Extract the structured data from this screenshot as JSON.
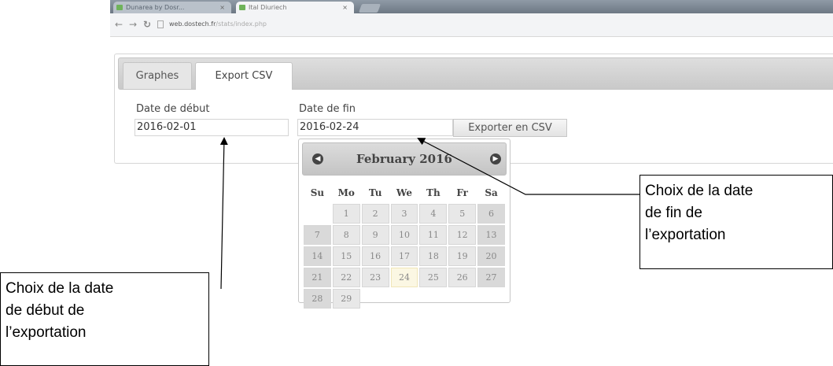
{
  "browser": {
    "tabs": [
      {
        "label": "Dunarea by Dosr..."
      },
      {
        "label": "Ital Diuriech"
      }
    ],
    "url_host": "web.dostech.fr",
    "url_path": "/stats/index.php"
  },
  "page": {
    "tabs": [
      {
        "label": "Graphes"
      },
      {
        "label": "Export CSV"
      }
    ],
    "start_date": {
      "label": "Date de début",
      "value": "2016-02-01"
    },
    "end_date": {
      "label": "Date de fin",
      "value": "2016-02-24"
    },
    "export_button": "Exporter en CSV"
  },
  "datepicker": {
    "month_title": "February 2016",
    "weekdays": [
      "Su",
      "Mo",
      "Tu",
      "We",
      "Th",
      "Fr",
      "Sa"
    ],
    "weeks": [
      [
        "",
        "1",
        "2",
        "3",
        "4",
        "5",
        "6"
      ],
      [
        "7",
        "8",
        "9",
        "10",
        "11",
        "12",
        "13"
      ],
      [
        "14",
        "15",
        "16",
        "17",
        "18",
        "19",
        "20"
      ],
      [
        "21",
        "22",
        "23",
        "24",
        "25",
        "26",
        "27"
      ],
      [
        "28",
        "29",
        "",
        "",
        "",
        "",
        ""
      ]
    ],
    "today": "24"
  },
  "annotations": {
    "end": [
      "Choix de la date",
      "de fin de",
      "l’exportation"
    ],
    "start": [
      "Choix de la date",
      "de début de",
      "l’exportation"
    ]
  }
}
